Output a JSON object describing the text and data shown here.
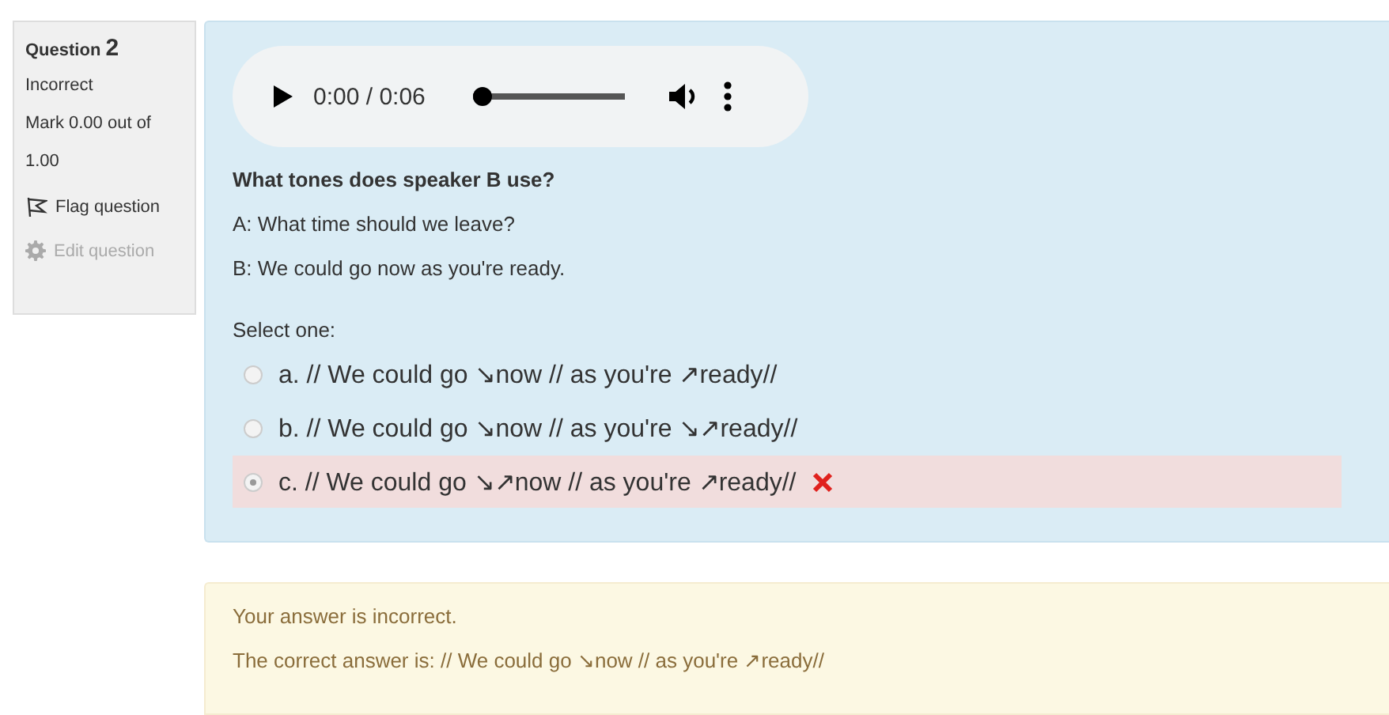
{
  "info": {
    "label": "Question",
    "number": "2",
    "state": "Incorrect",
    "mark": "Mark 0.00 out of",
    "mark_total": "1.00",
    "flag": {
      "label": "Flag question",
      "flagged": false
    },
    "edit": {
      "label": "Edit question",
      "disabled": true
    }
  },
  "player": {
    "time": "0:00 / 0:06",
    "level": 0
  },
  "question": {
    "prompt": "What tones does speaker B use?",
    "lines": [
      "A: What time should we leave?",
      "B: We could go now as you're ready."
    ]
  },
  "select_label": "Select one:",
  "options": [
    {
      "label": "a. // We could go ↘now // as you're ↗ready//",
      "selected": false,
      "incorrect": false
    },
    {
      "label": "b. // We could go ↘now // as you're ↘↗ready//",
      "selected": false,
      "incorrect": false
    },
    {
      "label": "c. // We could go ↘↗now // as you're ↗ready//",
      "selected": true,
      "incorrect": true
    }
  ],
  "feedback": [
    "Your answer is incorrect.",
    "The correct answer is: // We could go ↘now // as you're ↗ready//"
  ]
}
